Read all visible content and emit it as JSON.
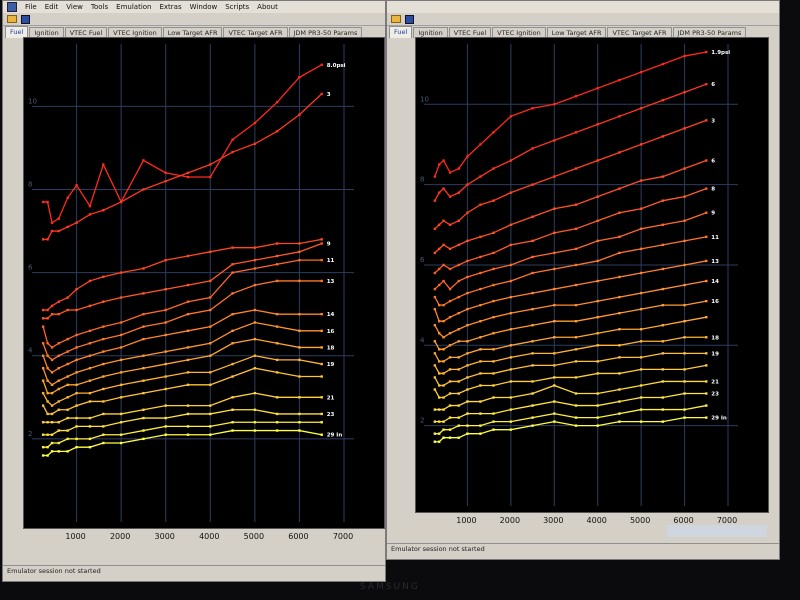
{
  "menu": [
    "File",
    "Edit",
    "View",
    "Tools",
    "Emulation",
    "Extras",
    "Window",
    "Scripts",
    "About"
  ],
  "left_tabs": [
    "Fuel",
    "Ignition",
    "VTEC Fuel",
    "VTEC Ignition",
    "Low Target AFR",
    "VTEC Target AFR",
    "JDM PR3-50 Params"
  ],
  "right_tabs": [
    "Fuel",
    "Ignition",
    "VTEC Fuel",
    "VTEC Ignition",
    "Low Target AFR",
    "VTEC Target AFR",
    "JDM PR3-50 Params"
  ],
  "status_text": "Emulator session not started",
  "brand": "SAMSUNG",
  "colors": {
    "red": "#ff2a1a",
    "yellow": "#ffff40",
    "grid": "#2c3d60",
    "plot_bg": "#000000"
  },
  "chart_data": [
    {
      "type": "line",
      "x_ticks": [
        "1000",
        "2000",
        "3000",
        "4000",
        "5000",
        "6000",
        "7000"
      ],
      "y_ticks": [
        "2",
        "4",
        "6",
        "8",
        "10"
      ],
      "xlim": [
        0,
        7000
      ],
      "ylim": [
        0,
        11.5
      ],
      "grid": true,
      "rpm": [
        250,
        350,
        450,
        600,
        800,
        1000,
        1300,
        1600,
        2000,
        2500,
        3000,
        3500,
        4000,
        4500,
        5000,
        5500,
        6000,
        6500
      ],
      "series": [
        {
          "label": "8.0psi",
          "y": [
            7.7,
            7.7,
            7.2,
            7.3,
            7.8,
            8.1,
            7.6,
            8.6,
            7.7,
            8.7,
            8.4,
            8.3,
            8.3,
            9.2,
            9.6,
            10.1,
            10.7,
            11.0
          ]
        },
        {
          "label": "3",
          "y": [
            6.8,
            6.8,
            7.0,
            7.0,
            7.1,
            7.2,
            7.4,
            7.5,
            7.7,
            8.0,
            8.2,
            8.4,
            8.6,
            8.9,
            9.1,
            9.4,
            9.8,
            10.3
          ]
        },
        {
          "label": "",
          "y": [
            5.1,
            5.1,
            5.2,
            5.3,
            5.4,
            5.6,
            5.8,
            5.9,
            6.0,
            6.1,
            6.3,
            6.4,
            6.5,
            6.6,
            6.6,
            6.7,
            6.7,
            6.8
          ]
        },
        {
          "label": "9",
          "y": [
            4.9,
            4.9,
            5.0,
            5.0,
            5.1,
            5.1,
            5.2,
            5.3,
            5.4,
            5.5,
            5.6,
            5.7,
            5.8,
            6.2,
            6.3,
            6.4,
            6.5,
            6.7
          ]
        },
        {
          "label": "11",
          "y": [
            4.7,
            4.3,
            4.2,
            4.3,
            4.4,
            4.5,
            4.6,
            4.7,
            4.8,
            5.0,
            5.1,
            5.3,
            5.4,
            6.0,
            6.1,
            6.2,
            6.3,
            6.3
          ]
        },
        {
          "label": "13",
          "y": [
            4.3,
            4.0,
            3.9,
            4.0,
            4.1,
            4.2,
            4.3,
            4.4,
            4.5,
            4.7,
            4.8,
            5.0,
            5.1,
            5.5,
            5.7,
            5.8,
            5.8,
            5.8
          ]
        },
        {
          "label": "14",
          "y": [
            4.0,
            3.7,
            3.6,
            3.7,
            3.8,
            3.9,
            4.0,
            4.1,
            4.2,
            4.4,
            4.5,
            4.6,
            4.7,
            5.0,
            5.1,
            5.0,
            5.0,
            5.0
          ]
        },
        {
          "label": "16",
          "y": [
            3.7,
            3.4,
            3.3,
            3.4,
            3.5,
            3.6,
            3.7,
            3.8,
            3.9,
            4.0,
            4.1,
            4.2,
            4.3,
            4.6,
            4.8,
            4.7,
            4.6,
            4.6
          ]
        },
        {
          "label": "18",
          "y": [
            3.4,
            3.1,
            3.1,
            3.2,
            3.3,
            3.3,
            3.4,
            3.5,
            3.6,
            3.7,
            3.8,
            3.9,
            4.0,
            4.3,
            4.4,
            4.3,
            4.2,
            4.2
          ]
        },
        {
          "label": "19",
          "y": [
            3.1,
            2.9,
            2.8,
            2.9,
            3.0,
            3.1,
            3.1,
            3.2,
            3.3,
            3.4,
            3.5,
            3.6,
            3.6,
            3.8,
            4.0,
            3.9,
            3.9,
            3.8
          ]
        },
        {
          "label": "",
          "y": [
            2.8,
            2.6,
            2.6,
            2.7,
            2.7,
            2.8,
            2.9,
            2.9,
            3.0,
            3.1,
            3.2,
            3.3,
            3.3,
            3.5,
            3.7,
            3.6,
            3.5,
            3.5
          ]
        },
        {
          "label": "21",
          "y": [
            2.4,
            2.4,
            2.4,
            2.4,
            2.5,
            2.5,
            2.5,
            2.6,
            2.6,
            2.7,
            2.8,
            2.8,
            2.8,
            3.0,
            3.1,
            3.0,
            3.0,
            3.0
          ]
        },
        {
          "label": "23",
          "y": [
            2.1,
            2.1,
            2.1,
            2.2,
            2.2,
            2.3,
            2.3,
            2.3,
            2.4,
            2.5,
            2.5,
            2.6,
            2.6,
            2.7,
            2.7,
            2.6,
            2.6,
            2.6
          ]
        },
        {
          "label": "",
          "y": [
            1.8,
            1.8,
            1.9,
            1.9,
            2.0,
            2.0,
            2.0,
            2.1,
            2.1,
            2.2,
            2.3,
            2.3,
            2.3,
            2.4,
            2.4,
            2.4,
            2.4,
            2.4
          ]
        },
        {
          "label": "29 In",
          "y": [
            1.6,
            1.6,
            1.7,
            1.7,
            1.7,
            1.8,
            1.8,
            1.9,
            1.9,
            2.0,
            2.1,
            2.1,
            2.1,
            2.2,
            2.2,
            2.2,
            2.2,
            2.1
          ]
        }
      ]
    },
    {
      "type": "line",
      "x_ticks": [
        "1000",
        "2000",
        "3000",
        "4000",
        "5000",
        "6000",
        "7000"
      ],
      "y_ticks": [
        "2",
        "4",
        "6",
        "8",
        "10"
      ],
      "xlim": [
        0,
        7000
      ],
      "ylim": [
        0,
        11.5
      ],
      "grid": true,
      "rpm": [
        250,
        350,
        450,
        600,
        800,
        1000,
        1300,
        1600,
        2000,
        2500,
        3000,
        3500,
        4000,
        4500,
        5000,
        5500,
        6000,
        6500
      ],
      "series": [
        {
          "label": "1.9psi",
          "y": [
            8.2,
            8.5,
            8.6,
            8.3,
            8.4,
            8.7,
            9.0,
            9.3,
            9.7,
            9.9,
            10.0,
            10.2,
            10.4,
            10.6,
            10.8,
            11.0,
            11.2,
            11.3
          ]
        },
        {
          "label": "6",
          "y": [
            7.6,
            7.8,
            7.9,
            7.7,
            7.8,
            8.0,
            8.2,
            8.4,
            8.6,
            8.9,
            9.1,
            9.3,
            9.5,
            9.7,
            9.9,
            10.1,
            10.3,
            10.5
          ]
        },
        {
          "label": "3",
          "y": [
            6.9,
            7.0,
            7.1,
            7.0,
            7.1,
            7.3,
            7.5,
            7.6,
            7.8,
            8.0,
            8.2,
            8.4,
            8.6,
            8.8,
            9.0,
            9.2,
            9.4,
            9.6
          ]
        },
        {
          "label": "6",
          "y": [
            6.3,
            6.4,
            6.5,
            6.4,
            6.5,
            6.6,
            6.7,
            6.8,
            7.0,
            7.2,
            7.4,
            7.5,
            7.7,
            7.9,
            8.1,
            8.2,
            8.4,
            8.6
          ]
        },
        {
          "label": "8",
          "y": [
            5.8,
            5.9,
            6.0,
            5.9,
            6.0,
            6.1,
            6.2,
            6.3,
            6.5,
            6.6,
            6.8,
            6.9,
            7.1,
            7.3,
            7.4,
            7.6,
            7.7,
            7.9
          ]
        },
        {
          "label": "9",
          "y": [
            5.4,
            5.5,
            5.6,
            5.4,
            5.6,
            5.7,
            5.8,
            5.9,
            6.0,
            6.2,
            6.3,
            6.4,
            6.6,
            6.7,
            6.9,
            7.0,
            7.1,
            7.3
          ]
        },
        {
          "label": "11",
          "y": [
            5.2,
            5.0,
            5.0,
            5.1,
            5.2,
            5.3,
            5.4,
            5.5,
            5.6,
            5.8,
            5.9,
            6.0,
            6.1,
            6.3,
            6.4,
            6.5,
            6.6,
            6.7
          ]
        },
        {
          "label": "13",
          "y": [
            4.9,
            4.6,
            4.6,
            4.7,
            4.8,
            4.9,
            5.0,
            5.1,
            5.2,
            5.3,
            5.4,
            5.5,
            5.6,
            5.7,
            5.8,
            5.9,
            6.0,
            6.1
          ]
        },
        {
          "label": "14",
          "y": [
            4.5,
            4.3,
            4.2,
            4.3,
            4.4,
            4.5,
            4.6,
            4.7,
            4.8,
            4.9,
            5.0,
            5.0,
            5.1,
            5.2,
            5.3,
            5.4,
            5.5,
            5.6
          ]
        },
        {
          "label": "16",
          "y": [
            4.1,
            3.9,
            3.9,
            4.0,
            4.1,
            4.1,
            4.2,
            4.3,
            4.4,
            4.5,
            4.6,
            4.6,
            4.7,
            4.8,
            4.9,
            5.0,
            5.0,
            5.1
          ]
        },
        {
          "label": "",
          "y": [
            3.8,
            3.6,
            3.6,
            3.7,
            3.7,
            3.8,
            3.9,
            3.9,
            4.0,
            4.1,
            4.2,
            4.2,
            4.3,
            4.4,
            4.4,
            4.5,
            4.6,
            4.7
          ]
        },
        {
          "label": "18",
          "y": [
            3.5,
            3.3,
            3.3,
            3.4,
            3.4,
            3.5,
            3.6,
            3.6,
            3.7,
            3.8,
            3.8,
            3.9,
            4.0,
            4.0,
            4.1,
            4.1,
            4.2,
            4.2
          ]
        },
        {
          "label": "19",
          "y": [
            3.2,
            3.0,
            3.0,
            3.1,
            3.1,
            3.2,
            3.3,
            3.3,
            3.4,
            3.5,
            3.5,
            3.6,
            3.6,
            3.7,
            3.7,
            3.8,
            3.8,
            3.8
          ]
        },
        {
          "label": "",
          "y": [
            2.9,
            2.7,
            2.7,
            2.8,
            2.8,
            2.9,
            3.0,
            3.0,
            3.1,
            3.1,
            3.2,
            3.2,
            3.3,
            3.3,
            3.4,
            3.4,
            3.4,
            3.5
          ]
        },
        {
          "label": "21",
          "y": [
            2.4,
            2.4,
            2.4,
            2.5,
            2.5,
            2.6,
            2.6,
            2.7,
            2.7,
            2.8,
            3.0,
            2.8,
            2.8,
            2.9,
            3.0,
            3.1,
            3.1,
            3.1
          ]
        },
        {
          "label": "23",
          "y": [
            2.1,
            2.1,
            2.1,
            2.2,
            2.2,
            2.3,
            2.3,
            2.3,
            2.4,
            2.5,
            2.6,
            2.5,
            2.5,
            2.6,
            2.7,
            2.7,
            2.8,
            2.8
          ]
        },
        {
          "label": "",
          "y": [
            1.8,
            1.8,
            1.9,
            1.9,
            2.0,
            2.0,
            2.0,
            2.1,
            2.1,
            2.2,
            2.3,
            2.2,
            2.2,
            2.3,
            2.4,
            2.4,
            2.4,
            2.5
          ]
        },
        {
          "label": "29 In",
          "y": [
            1.6,
            1.6,
            1.7,
            1.7,
            1.7,
            1.8,
            1.8,
            1.9,
            1.9,
            2.0,
            2.1,
            2.0,
            2.0,
            2.1,
            2.1,
            2.1,
            2.2,
            2.2
          ]
        }
      ]
    }
  ]
}
